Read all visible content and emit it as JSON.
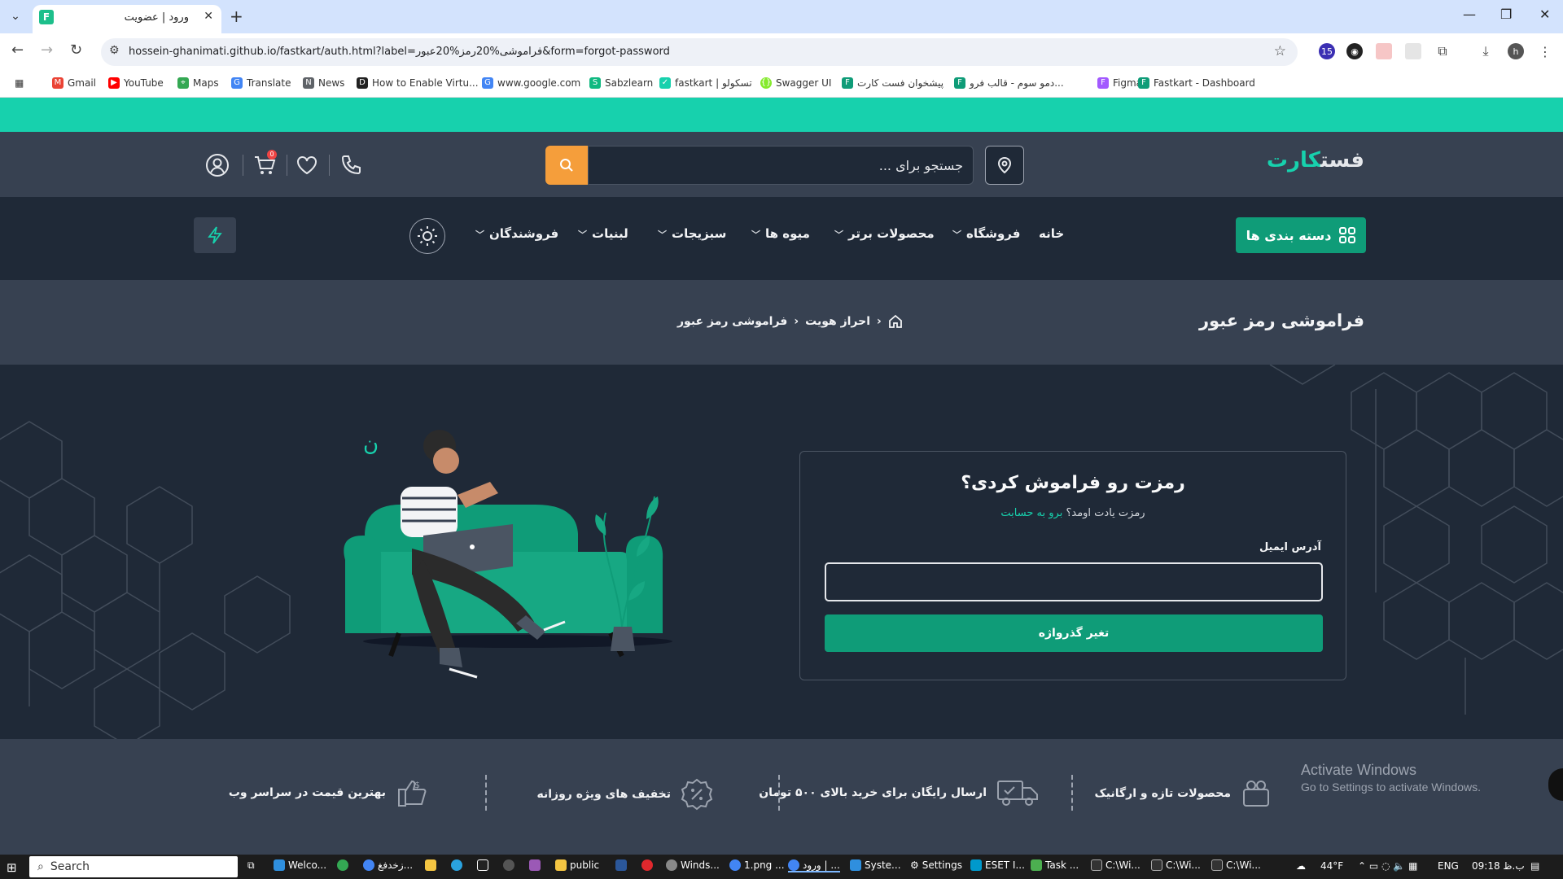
{
  "browser": {
    "tab_title": "ورود | عضویت",
    "url": "hossein-ghanimati.github.io/fastkart/auth.html?label=فراموشی%20رمز%20عبور&form=forgot-password",
    "bookmarks": [
      {
        "label": "Gmail",
        "color": "#ea4335"
      },
      {
        "label": "YouTube",
        "color": "#ff0000"
      },
      {
        "label": "Maps",
        "color": "#34a853"
      },
      {
        "label": "Translate",
        "color": "#4285f4"
      },
      {
        "label": "News",
        "color": "#5f6368"
      },
      {
        "label": "How to Enable Virtu...",
        "color": "#222222"
      },
      {
        "label": "www.google.com",
        "color": "#4285f4"
      },
      {
        "label": "Sabzlearn",
        "color": "#10b981"
      },
      {
        "label": "fastkart | تسکولو",
        "color": "#17d1ad"
      },
      {
        "label": "Swagger UI",
        "color": "#85ea2d"
      },
      {
        "label": "پیشخوان فست کارت",
        "color": "#0f9c78"
      },
      {
        "label": "دمو سوم - قالب فرو...",
        "color": "#0f9c78"
      },
      {
        "label": "Figma",
        "color": "#a259ff"
      },
      {
        "label": "Fastkart - Dashboard",
        "color": "#0f9c78"
      }
    ],
    "profile_initial": "h",
    "extension_badge": "15"
  },
  "header": {
    "logo_main": "فست",
    "logo_accent": "کارت",
    "search_placeholder": "جستجو برای ...",
    "cart_badge": "0"
  },
  "nav": {
    "categories_label": "دسته بندی ها",
    "items": [
      "خانه",
      "فروشگاه",
      "محصولات برتر",
      "میوه ها",
      "سبزیجات",
      "لبنیات",
      "فروشندگان"
    ]
  },
  "breadcrumb": {
    "page_title": "فراموشی رمز عبور",
    "level1": "احراز هویت",
    "level2": "فراموشی رمز عبور"
  },
  "form": {
    "title": "رمزت رو فراموش کردی؟",
    "subtitle_text": "رمزت یادت اومد؟",
    "subtitle_link": "برو به حسابت",
    "email_label": "آدرس ایمیل",
    "email_value": "",
    "submit_label": "تغیر گذرواژه"
  },
  "services": [
    {
      "label": "محصولات تازه و ارگانیک",
      "icon": "fresh-products-icon"
    },
    {
      "label": "ارسال رایگان برای خرید بالای ۵۰۰ تومان",
      "icon": "delivery-truck-icon"
    },
    {
      "label": "تخفیف های ویژه روزانه",
      "icon": "discount-icon"
    },
    {
      "label": "بهترین قیمت در سراسر وب",
      "icon": "best-price-icon"
    }
  ],
  "watermark": {
    "title": "Activate Windows",
    "subtitle": "Go to Settings to activate Windows."
  },
  "taskbar": {
    "search_label": "Search",
    "apps": [
      "Welco...",
      "زخدفغ...",
      "public",
      "Winds...",
      "1.png ...",
      "ورود | ...",
      "Syste...",
      "Settings",
      "ESET I...",
      "Task ...",
      "C:\\Wi...",
      "C:\\Wi...",
      "C:\\Wi..."
    ],
    "weather": "44°F",
    "language": "ENG",
    "clock": "09:18 ب.ظ"
  }
}
